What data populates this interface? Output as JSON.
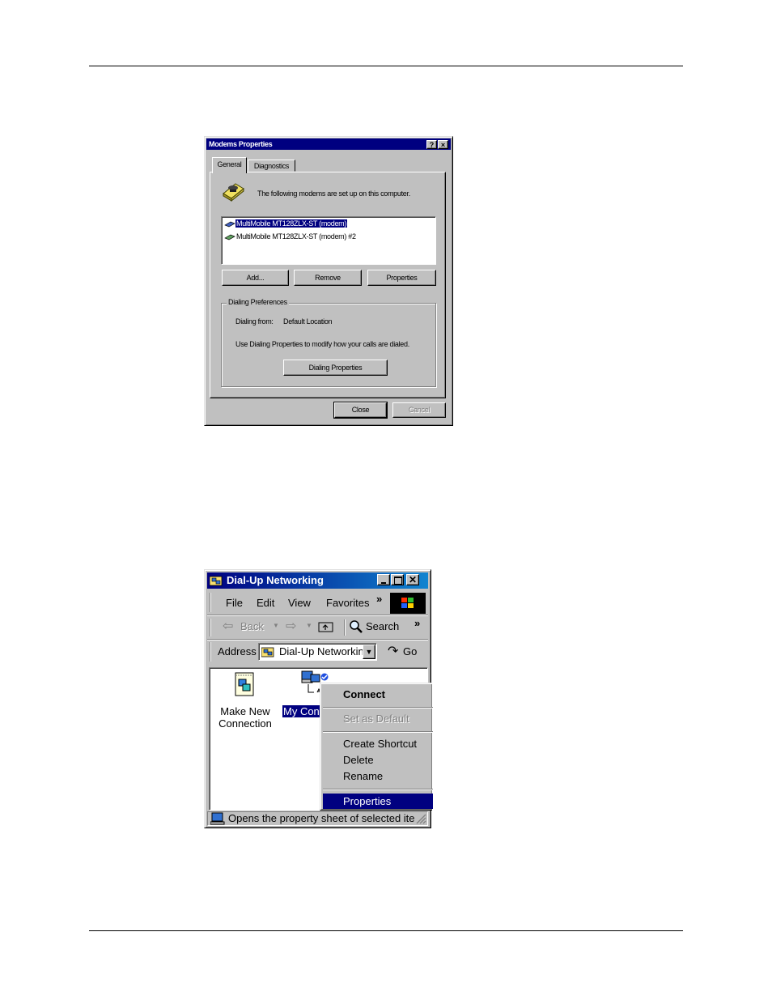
{
  "modems_dialog": {
    "title": "Modems Properties",
    "help_button": "?",
    "close_button": "×",
    "tabs": [
      {
        "label": "General"
      },
      {
        "label": "Diagnostics"
      }
    ],
    "intro": "The following modems are set up on this computer.",
    "modems": [
      {
        "label": "MultiMobile MT128ZLX-ST (modem)"
      },
      {
        "label": "MultiMobile MT128ZLX-ST (modem) #2"
      }
    ],
    "buttons": {
      "add": "Add...",
      "remove": "Remove",
      "properties": "Properties"
    },
    "dialing": {
      "group_label": "Dialing Preferences",
      "from_label": "Dialing from:",
      "from_value": "Default Location",
      "help_text": "Use Dialing Properties to modify how your calls are dialed.",
      "button": "Dialing Properties"
    },
    "footer": {
      "close": "Close",
      "cancel": "Cancel"
    }
  },
  "dun_window": {
    "title": "Dial-Up Networking",
    "menu": [
      "File",
      "Edit",
      "View",
      "Favorites"
    ],
    "toolbar": {
      "back": "Back",
      "search": "Search",
      "more": "»"
    },
    "address": {
      "label": "Address",
      "value": "Dial-Up Networkin",
      "go": "Go"
    },
    "items": {
      "make_new": [
        "Make New",
        "Connection"
      ],
      "my_connection": "My Conn"
    },
    "context_menu": [
      "Connect",
      "Set as Default",
      "Create Shortcut",
      "Delete",
      "Rename",
      "Properties"
    ],
    "status": "Opens the property sheet of selected iten"
  },
  "colors": {
    "titlebar": "#000080",
    "face": "#c0c0c0",
    "selection": "#000080"
  }
}
